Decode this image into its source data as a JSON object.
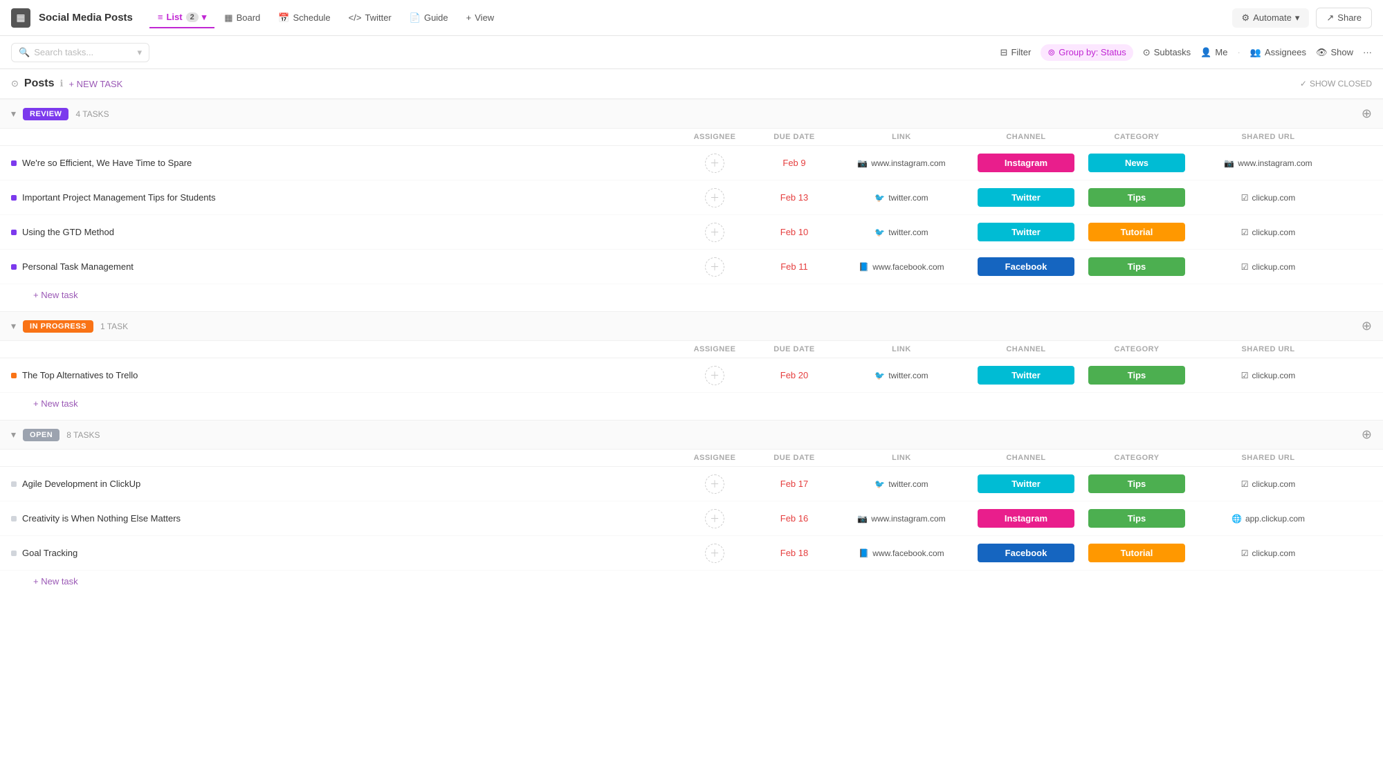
{
  "app": {
    "icon": "▦",
    "title": "Social Media Posts"
  },
  "nav": {
    "tabs": [
      {
        "id": "list",
        "icon": "≡",
        "label": "List",
        "badge": "2",
        "active": true
      },
      {
        "id": "board",
        "icon": "▦",
        "label": "Board",
        "active": false
      },
      {
        "id": "schedule",
        "icon": "📅",
        "label": "Schedule",
        "active": false
      },
      {
        "id": "twitter",
        "icon": "</>",
        "label": "Twitter",
        "active": false
      },
      {
        "id": "guide",
        "icon": "📄",
        "label": "Guide",
        "active": false
      },
      {
        "id": "view",
        "icon": "+",
        "label": "View",
        "active": false
      }
    ],
    "automate_label": "Automate",
    "share_label": "Share"
  },
  "toolbar": {
    "search_placeholder": "Search tasks...",
    "filter_label": "Filter",
    "group_by_label": "Group by: Status",
    "subtasks_label": "Subtasks",
    "me_label": "Me",
    "assignees_label": "Assignees",
    "show_label": "Show",
    "more_label": "···"
  },
  "posts_section": {
    "title": "Posts",
    "new_task_label": "+ NEW TASK",
    "show_closed_label": "SHOW CLOSED"
  },
  "review_group": {
    "label": "REVIEW",
    "task_count": "4 TASKS",
    "columns": [
      "ASSIGNEE",
      "DUE DATE",
      "LINK",
      "CHANNEL",
      "CATEGORY",
      "SHARED URL"
    ],
    "tasks": [
      {
        "name": "We're so Efficient, We Have Time to Spare",
        "dot": "purple",
        "due_date": "Feb 9",
        "link_icon": "instagram",
        "link_text": "www.instagram.com",
        "channel": "Instagram",
        "channel_type": "instagram",
        "category": "News",
        "category_type": "news",
        "shared_url_icon": "instagram",
        "shared_url": "www.instagram.com"
      },
      {
        "name": "Important Project Management Tips for Students",
        "dot": "purple",
        "due_date": "Feb 13",
        "link_icon": "twitter",
        "link_text": "twitter.com",
        "channel": "Twitter",
        "channel_type": "twitter",
        "category": "Tips",
        "category_type": "tips",
        "shared_url_icon": "clickup",
        "shared_url": "clickup.com"
      },
      {
        "name": "Using the GTD Method",
        "dot": "purple",
        "due_date": "Feb 10",
        "link_icon": "twitter",
        "link_text": "twitter.com",
        "channel": "Twitter",
        "channel_type": "twitter",
        "category": "Tutorial",
        "category_type": "tutorial",
        "shared_url_icon": "clickup",
        "shared_url": "clickup.com"
      },
      {
        "name": "Personal Task Management",
        "dot": "purple",
        "due_date": "Feb 11",
        "link_icon": "facebook",
        "link_text": "www.facebook.com",
        "channel": "Facebook",
        "channel_type": "facebook",
        "category": "Tips",
        "category_type": "tips",
        "shared_url_icon": "clickup",
        "shared_url": "clickup.com"
      }
    ],
    "new_task_label": "+ New task"
  },
  "inprogress_group": {
    "label": "IN PROGRESS",
    "task_count": "1 TASK",
    "columns": [
      "ASSIGNEE",
      "DUE DATE",
      "LINK",
      "CHANNEL",
      "CATEGORY",
      "SHARED URL"
    ],
    "tasks": [
      {
        "name": "The Top Alternatives to Trello",
        "dot": "orange",
        "due_date": "Feb 20",
        "link_icon": "twitter",
        "link_text": "twitter.com",
        "channel": "Twitter",
        "channel_type": "twitter",
        "category": "Tips",
        "category_type": "tips",
        "shared_url_icon": "clickup",
        "shared_url": "clickup.com"
      }
    ],
    "new_task_label": "+ New task"
  },
  "open_group": {
    "label": "OPEN",
    "task_count": "8 TASKS",
    "columns": [
      "ASSIGNEE",
      "DUE DATE",
      "LINK",
      "CHANNEL",
      "CATEGORY",
      "SHARED URL"
    ],
    "tasks": [
      {
        "name": "Agile Development in ClickUp",
        "dot": "gray",
        "due_date": "Feb 17",
        "link_icon": "twitter",
        "link_text": "twitter.com",
        "channel": "Twitter",
        "channel_type": "twitter",
        "category": "Tips",
        "category_type": "tips",
        "shared_url_icon": "clickup",
        "shared_url": "clickup.com"
      },
      {
        "name": "Creativity is When Nothing Else Matters",
        "dot": "gray",
        "due_date": "Feb 16",
        "link_icon": "instagram",
        "link_text": "www.instagram.com",
        "channel": "Instagram",
        "channel_type": "instagram",
        "category": "Tips",
        "category_type": "tips",
        "shared_url_icon": "globe",
        "shared_url": "app.clickup.com"
      },
      {
        "name": "Goal Tracking",
        "dot": "gray",
        "due_date": "Feb 18",
        "link_icon": "facebook",
        "link_text": "www.facebook.com",
        "channel": "Facebook",
        "channel_type": "facebook",
        "category": "Tutorial",
        "category_type": "tutorial",
        "shared_url_icon": "clickup",
        "shared_url": "clickup.com"
      }
    ],
    "new_task_label": "+ New task"
  },
  "icons": {
    "instagram": "📷",
    "twitter": "🐦",
    "facebook": "📘",
    "clickup": "☑",
    "globe": "🌐",
    "search": "🔍",
    "filter": "⊟",
    "group": "⊚",
    "subtasks": "⊙",
    "user": "👤",
    "users": "👥",
    "eye": "👁",
    "chevron_down": "▾",
    "chevron_right": "▸",
    "plus": "+",
    "check": "✓",
    "info": "ℹ"
  }
}
